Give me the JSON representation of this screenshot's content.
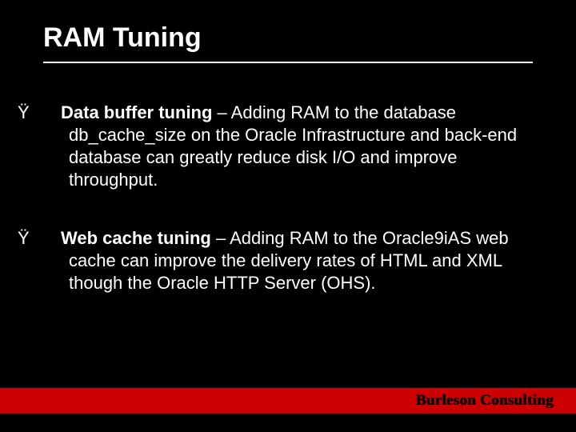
{
  "title": "RAM Tuning",
  "bullet_mark": "Ÿ",
  "bullets": [
    {
      "bold": "Data buffer tuning",
      "rest": " – Adding RAM to the database db_cache_size on the Oracle Infrastructure and back-end database can greatly reduce disk I/O and improve throughput."
    },
    {
      "bold": "Web cache tuning",
      "rest": " – Adding RAM to the Oracle9iAS web cache can improve the delivery rates of HTML and XML though the Oracle HTTP Server (OHS)."
    }
  ],
  "footer_brand": "Burleson Consulting"
}
